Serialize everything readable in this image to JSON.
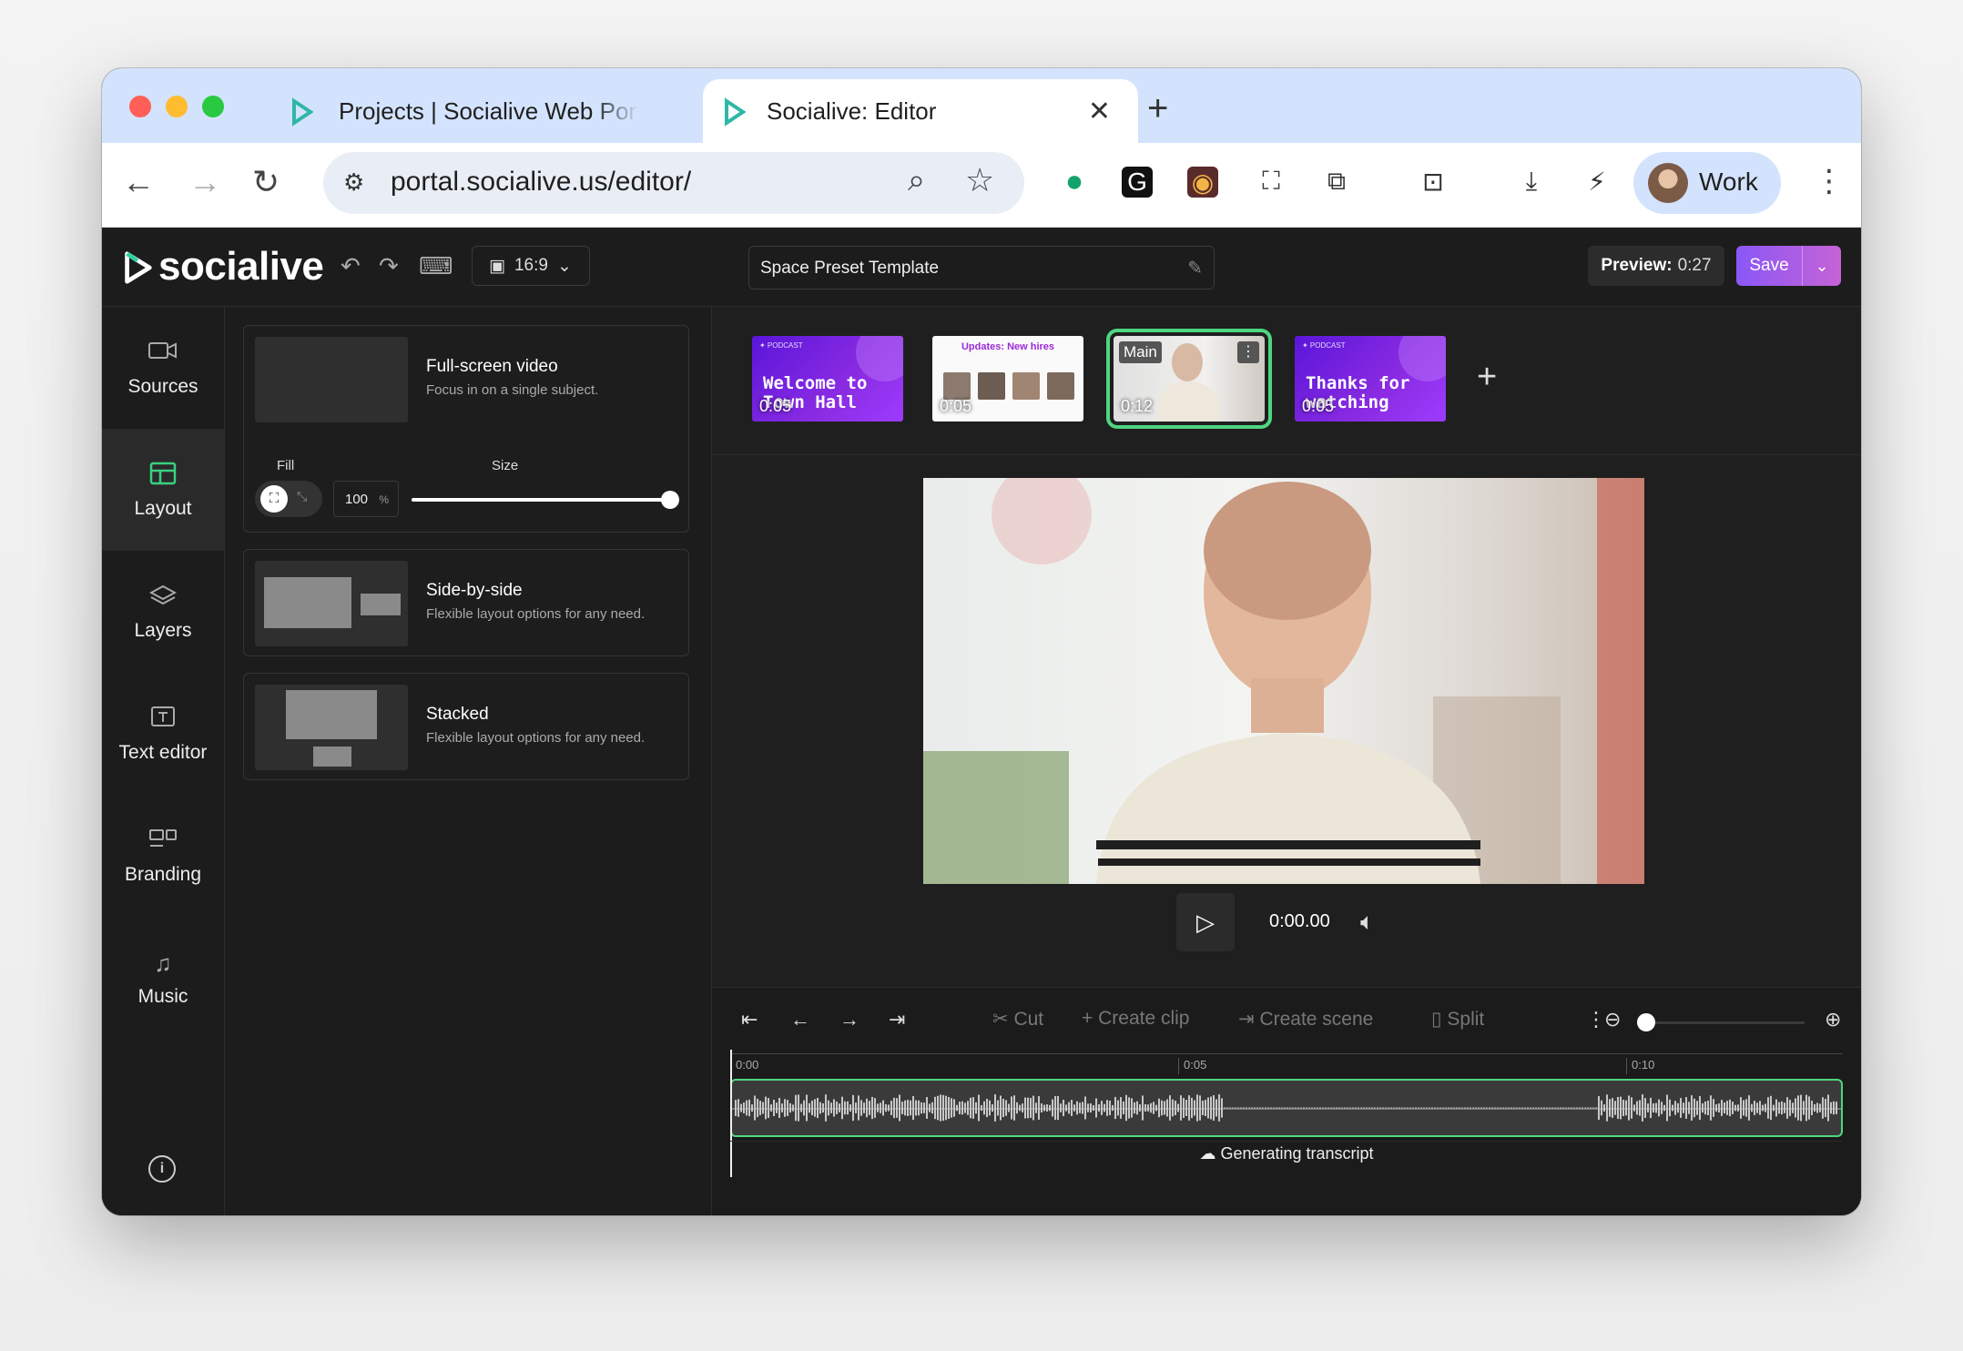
{
  "browser": {
    "tabs": [
      {
        "title": "Projects | Socialive Web Portal",
        "active": false
      },
      {
        "title": "Socialive: Editor",
        "active": true
      }
    ],
    "url": "portal.socialive.us/editor/",
    "profile_label": "Work"
  },
  "header": {
    "logo_text": "socialive",
    "aspect_ratio": "16:9",
    "title": "Space Preset Template",
    "preview_label": "Preview:",
    "preview_time": "0:27",
    "save_label": "Save"
  },
  "sidebar": {
    "items": [
      {
        "label": "Sources",
        "icon": "video-camera-icon",
        "selected": false
      },
      {
        "label": "Layout",
        "icon": "layout-icon",
        "selected": true
      },
      {
        "label": "Layers",
        "icon": "layers-icon",
        "selected": false
      },
      {
        "label": "Text editor",
        "icon": "text-icon",
        "selected": false
      },
      {
        "label": "Branding",
        "icon": "branding-icon",
        "selected": false
      },
      {
        "label": "Music",
        "icon": "music-icon",
        "selected": false
      }
    ]
  },
  "layouts": {
    "fullscreen": {
      "title": "Full-screen video",
      "desc": "Focus in on a single subject.",
      "fill_label": "Fill",
      "size_label": "Size",
      "size_value": "100",
      "size_unit": "%",
      "size_fraction": 1.0
    },
    "side_by_side": {
      "title": "Side-by-side",
      "desc": "Flexible layout options for any need."
    },
    "stacked": {
      "title": "Stacked",
      "desc": "Flexible layout options for any need."
    }
  },
  "scenes": [
    {
      "title": "Welcome to Town Hall",
      "duration": "0:05"
    },
    {
      "title": "Updates: New hires",
      "duration": "0:05"
    },
    {
      "label": "Main",
      "duration": "0:12",
      "selected": true
    },
    {
      "title": "Thanks for watching",
      "duration": "0:05"
    }
  ],
  "player": {
    "time": "0:00.00"
  },
  "timeline": {
    "tools": {
      "cut": "Cut",
      "create_clip": "Create clip",
      "create_scene": "Create scene",
      "split": "Split"
    },
    "ticks": [
      "0:00",
      "0:05",
      "0:10"
    ],
    "status": "Generating transcript"
  },
  "colors": {
    "accent": "#4ed67f",
    "save_start": "#8a57f7",
    "save_end": "#c663d6",
    "scene_purple": "#6a1fe0"
  }
}
